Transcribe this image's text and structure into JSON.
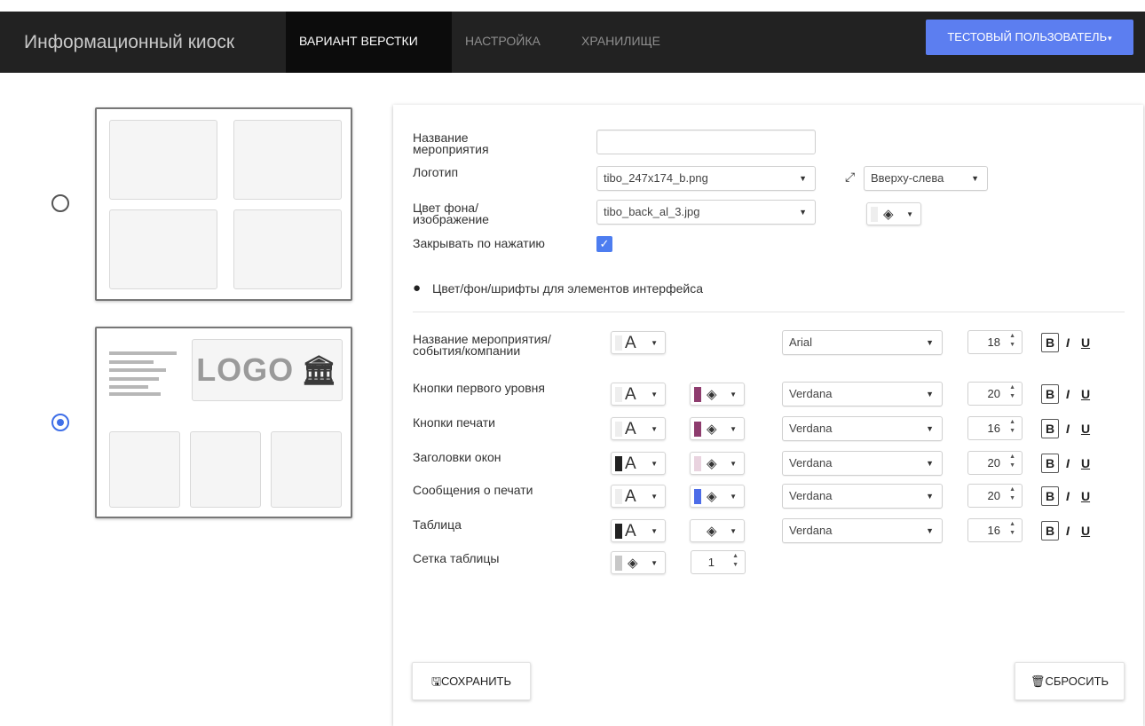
{
  "app": {
    "brand": "Информационный киоск",
    "nav": [
      "ВАРИАНТ ВЕРСТКИ",
      "НАСТРОЙКА",
      "ХРАНИЛИЩЕ"
    ],
    "active_nav": 0,
    "user_button": "ТЕСТОВЫЙ ПОЛЬЗОВАТЕЛЬ"
  },
  "layouts": {
    "options": [
      "grid-2x2",
      "logo-header-3-tiles"
    ],
    "selected": 1,
    "logo_text": "LOGO"
  },
  "event": {
    "name_label": "Название мероприятия",
    "name_value": "",
    "logo_label": "Логотип",
    "logo_file": "tibo_247x174_b.png",
    "logo_position": "Вверху-слева",
    "bg_label": "Цвет фона/ изображение",
    "bg_file": "tibo_back_al_3.jpg",
    "close_label": "Закрывать по нажатию",
    "close_checked": true
  },
  "section": {
    "title": "Цвет/фон/шрифты для элементов интерфейса",
    "icon": "palette-icon"
  },
  "styles": [
    {
      "label": "Название мероприятия/ события/компании",
      "text_color": "#eeeeee",
      "bg_color": null,
      "font": "Arial",
      "size": "18"
    },
    {
      "label": "Кнопки первого уровня",
      "text_color": "#eeeeee",
      "bg_color": "#8e3c6e",
      "font": "Verdana",
      "size": "20"
    },
    {
      "label": "Кнопки печати",
      "text_color": "#eeeeee",
      "bg_color": "#8e3c6e",
      "font": "Verdana",
      "size": "16"
    },
    {
      "label": "Заголовки окон",
      "text_color": "#222222",
      "bg_color": "#e9d3df",
      "font": "Verdana",
      "size": "20"
    },
    {
      "label": "Сообщения о печати",
      "text_color": "#eeeeee",
      "bg_color": "#4c6ce8",
      "font": "Verdana",
      "size": "20"
    },
    {
      "label": "Таблица",
      "text_color": "#222222",
      "bg_color": "#ffffff",
      "font": "Verdana",
      "size": "16"
    }
  ],
  "grid": {
    "label": "Сетка таблицы",
    "color": "#c8c8c8",
    "width": "1"
  },
  "format_buttons": {
    "bold": "B",
    "italic": "I",
    "underline": "U"
  },
  "actions": {
    "save": "СОХРАНИТЬ",
    "reset": "СБРОСИТЬ"
  }
}
